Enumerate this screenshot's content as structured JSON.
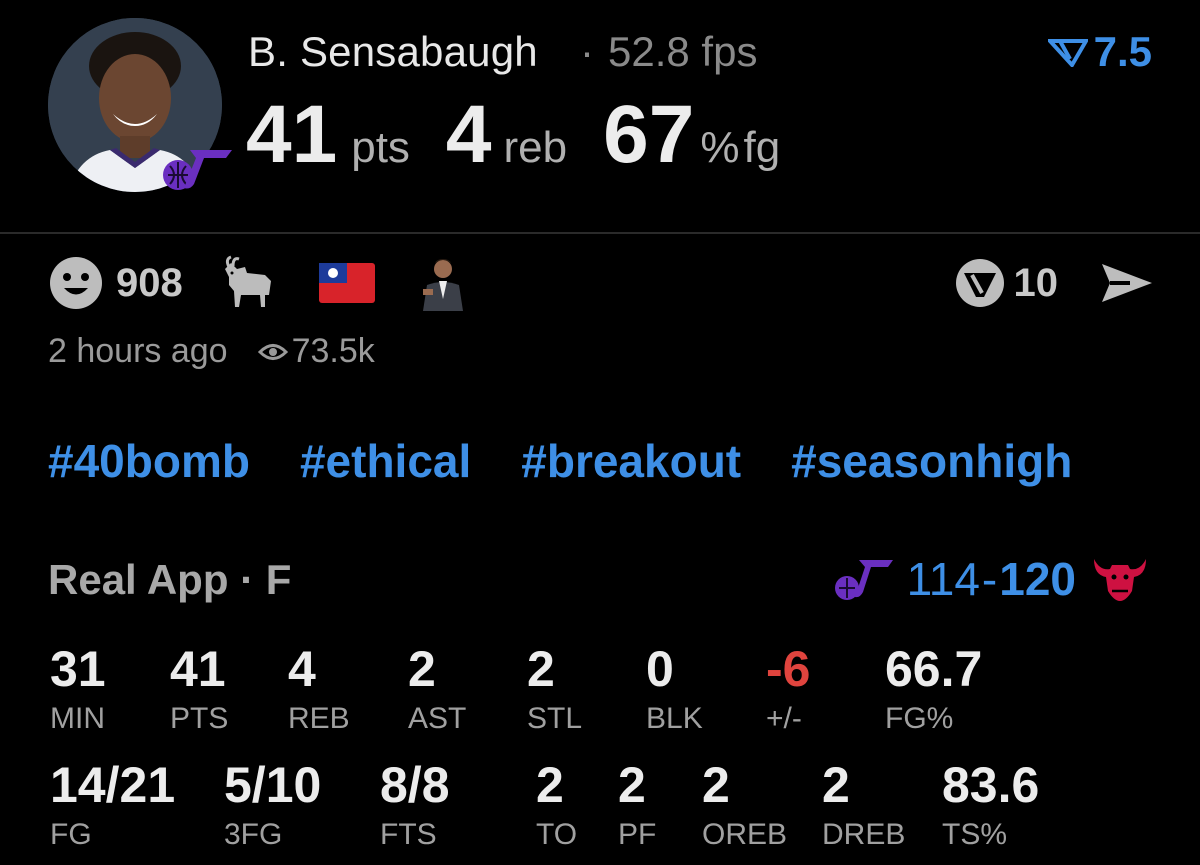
{
  "player": {
    "name": "B. Sensabaugh",
    "separator": "·",
    "fps": "52.8 fps"
  },
  "rating": {
    "icon": "real-rating-icon",
    "value": "7.5"
  },
  "headline": {
    "pts": {
      "value": "41",
      "unit": "pts"
    },
    "reb": {
      "value": "4",
      "unit": "reb"
    },
    "fg": {
      "value": "67",
      "unit_pct": "%",
      "unit": "fg"
    }
  },
  "reactions": {
    "smile_count": "908",
    "emojis": [
      "smile-icon",
      "goat-icon",
      "taiwan-flag-icon",
      "man-in-suit-icon"
    ]
  },
  "actions": {
    "comment_count": "10",
    "icons": [
      "comment-v-icon",
      "share-send-icon"
    ]
  },
  "meta": {
    "time": "2 hours ago",
    "views": "73.5k"
  },
  "tags": [
    "#40bomb",
    "#ethical",
    "#breakout",
    "#seasonhigh"
  ],
  "game": {
    "source": "Real App · F",
    "score_home": "114",
    "score_dash": "-",
    "score_away": "120"
  },
  "stats_row1": [
    {
      "v": "31",
      "l": "MIN"
    },
    {
      "v": "41",
      "l": "PTS"
    },
    {
      "v": "4",
      "l": "REB"
    },
    {
      "v": "2",
      "l": "AST"
    },
    {
      "v": "2",
      "l": "STL"
    },
    {
      "v": "0",
      "l": "BLK"
    },
    {
      "v": "-6",
      "l": "+/-"
    },
    {
      "v": "66.7",
      "l": "FG%"
    }
  ],
  "stats_row2": [
    {
      "v": "14/21",
      "l": "FG"
    },
    {
      "v": "5/10",
      "l": "3FG"
    },
    {
      "v": "8/8",
      "l": "FTS"
    },
    {
      "v": "2",
      "l": "TO"
    },
    {
      "v": "2",
      "l": "PF"
    },
    {
      "v": "2",
      "l": "OREB"
    },
    {
      "v": "2",
      "l": "DREB"
    },
    {
      "v": "83.6",
      "l": "TS%"
    }
  ],
  "colors": {
    "accent": "#3e8fe6",
    "negative": "#e0443e",
    "jazz_purple": "#6a2fc0",
    "bulls_red": "#ce1141"
  }
}
